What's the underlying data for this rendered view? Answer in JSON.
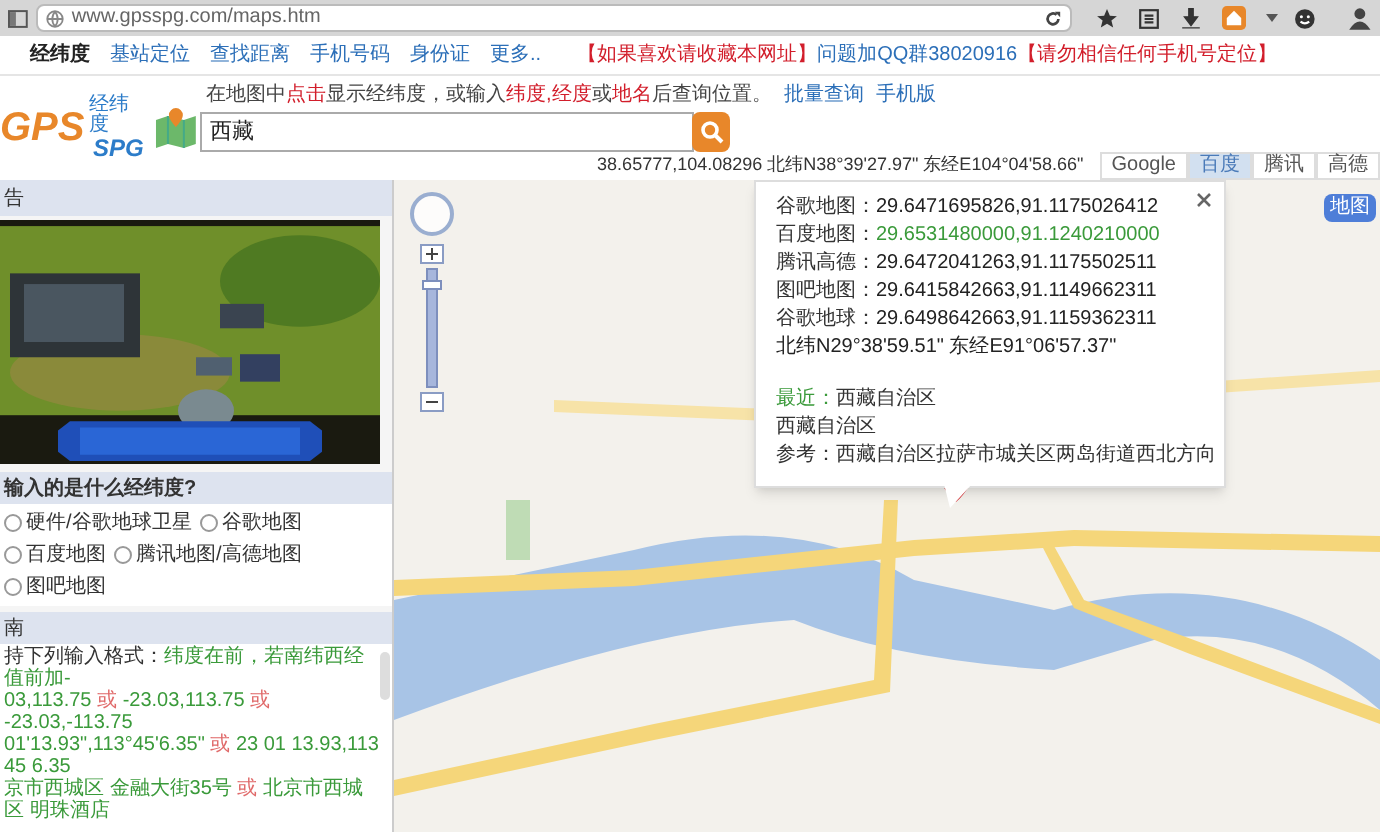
{
  "browser": {
    "url": "www.gpsspg.com/maps.htm"
  },
  "nav": {
    "items": [
      {
        "label": "经纬度",
        "selected": true
      },
      {
        "label": "基站定位",
        "selected": false
      },
      {
        "label": "查找距离",
        "selected": false
      },
      {
        "label": "手机号码",
        "selected": false
      },
      {
        "label": "身份证",
        "selected": false
      },
      {
        "label": "更多..",
        "selected": false
      }
    ],
    "notices": [
      {
        "text": "【如果喜欢请收藏本网址】",
        "kind": "warning"
      },
      {
        "text": "问题加QQ群38020916",
        "kind": "contact"
      },
      {
        "text": "【请勿相信任何手机号定位】",
        "kind": "warning"
      }
    ]
  },
  "logo": {
    "gps": "GPS",
    "subtitle": "经纬度",
    "spg": "SPG"
  },
  "search": {
    "hint": [
      {
        "text": "在地图中",
        "kind": "plain"
      },
      {
        "text": "点击",
        "kind": "highlight"
      },
      {
        "text": "显示经纬度，或输入",
        "kind": "plain"
      },
      {
        "text": "纬度,经度",
        "kind": "highlight"
      },
      {
        "text": "或",
        "kind": "plain"
      },
      {
        "text": "地名",
        "kind": "highlight"
      },
      {
        "text": "后查询位置。",
        "kind": "plain"
      }
    ],
    "links": [
      "批量查询",
      "手机版"
    ],
    "value": "西藏"
  },
  "coordinates": "38.65777,104.08296 北纬N38°39'27.97\" 东经E104°04'58.66\"",
  "map_types": [
    {
      "label": "Google",
      "selected": false
    },
    {
      "label": "百度",
      "selected": true
    },
    {
      "label": "腾讯",
      "selected": false
    },
    {
      "label": "高德",
      "selected": false
    }
  ],
  "map_button": "地图",
  "zoom": {
    "level": 0.9
  },
  "sidebar": {
    "ad_title": "告",
    "question": "输入的是什么经纬度?",
    "options": [
      {
        "label": "硬件/谷歌地球卫星",
        "selected": false
      },
      {
        "label": "谷歌地图",
        "selected": false
      },
      {
        "label": "百度地图",
        "selected": false
      },
      {
        "label": "腾讯地图/高德地图",
        "selected": false
      },
      {
        "label": "图吧地图",
        "selected": false
      }
    ],
    "help_title": "南",
    "help_lines": [
      [
        {
          "text": "持下列输入格式：",
          "kind": "plain"
        },
        {
          "text": "纬度在前，若南纬西经值前加-",
          "kind": "value"
        }
      ],
      [
        {
          "text": "03,113.75",
          "kind": "value"
        },
        {
          "text": " 或 ",
          "kind": "sep"
        },
        {
          "text": "-23.03,113.75",
          "kind": "value"
        },
        {
          "text": " 或 ",
          "kind": "sep"
        },
        {
          "text": "-23.03,-113.75",
          "kind": "value"
        }
      ],
      [
        {
          "text": "01'13.93\",113°45'6.35\"",
          "kind": "value"
        },
        {
          "text": " 或 ",
          "kind": "sep"
        },
        {
          "text": "23 01 13.93,113 45 6.35",
          "kind": "value"
        }
      ],
      [
        {
          "text": "京市西城区 金融大街35号",
          "kind": "value"
        },
        {
          "text": " 或 ",
          "kind": "sep"
        },
        {
          "text": "北京市西城区 明珠酒店",
          "kind": "value"
        }
      ]
    ]
  },
  "popup": {
    "rows": [
      {
        "label": "谷歌地图：",
        "value": "29.6471695826,91.1175026412",
        "highlight": false
      },
      {
        "label": "百度地图：",
        "value": "29.6531480000,91.1240210000",
        "highlight": true
      },
      {
        "label": "腾讯高德：",
        "value": "29.6472041263,91.1175502511",
        "highlight": false
      },
      {
        "label": "图吧地图：",
        "value": "29.6415842663,91.1149662311",
        "highlight": false
      },
      {
        "label": "谷歌地球：",
        "value": "29.6498642663,91.1159362311",
        "highlight": false
      }
    ],
    "dms": "北纬N29°38'59.51\" 东经E91°06'57.37\"",
    "nearest": {
      "label": "最近：",
      "value": "西藏自治区"
    },
    "region": "西藏自治区",
    "reference": "参考：西藏自治区拉萨市城关区两岛街道西北方向"
  }
}
